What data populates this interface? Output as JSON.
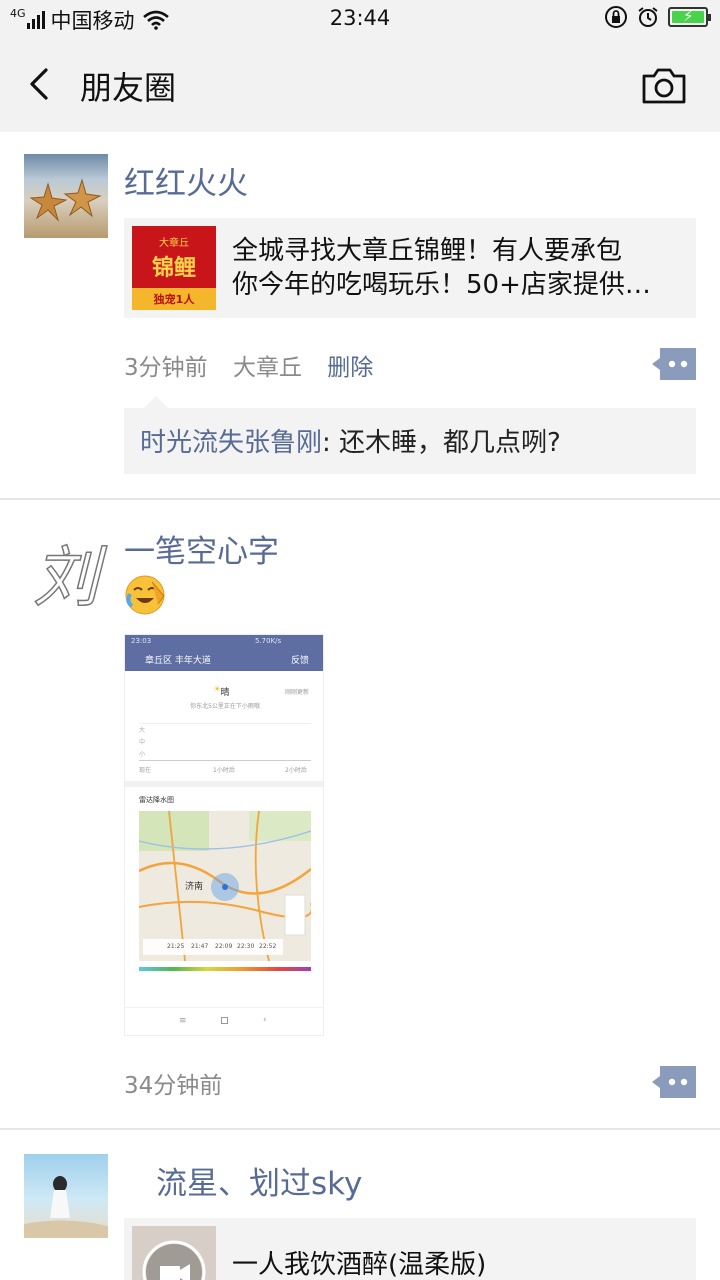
{
  "status_bar": {
    "network": "4G",
    "carrier": "中国移动",
    "time": "23:44"
  },
  "nav": {
    "title": "朋友圈"
  },
  "posts": [
    {
      "username": "红红火火",
      "link": {
        "thumb_top": "大章丘",
        "thumb_mid": "锦鲤",
        "thumb_bottom": "独宠1人",
        "line1": "全城寻找大章丘锦鲤！有人要承包",
        "line2": "你今年的吃喝玩乐！50+店家提供…"
      },
      "time": "3分钟前",
      "location": "大章丘",
      "delete_label": "删除",
      "comment": {
        "author": "时光流失张鲁刚",
        "separator": ": ",
        "text": "还木睡，都几点咧?"
      }
    },
    {
      "username": "一笔空心字",
      "avatar_text": "刘",
      "emoji": "crying-laughing-face",
      "screenshot": {
        "status_time": "23:03",
        "status_speed": "5.70K/s",
        "bar_title": "章丘区 丰年大道",
        "bar_feedback": "反馈",
        "weather": "晴",
        "weather_sub": "你东北5公里正在下小雨哦",
        "updated": "刚刚更新",
        "radar_title": "雷达降水图",
        "city": "济南",
        "levels": [
          "大",
          "中",
          "小"
        ],
        "times": [
          "现在",
          "1小时后",
          "2小时后"
        ],
        "timeline": [
          "21:25",
          "21:47",
          "22:09",
          "22:30",
          "22:52"
        ]
      },
      "time": "34分钟前"
    },
    {
      "username": "流星、划过sky",
      "music": {
        "title": "一人我饮酒醉(温柔版)"
      }
    }
  ],
  "colors": {
    "link_blue": "#576b95",
    "bar_bg": "#f2f2f2",
    "card_bg": "#f3f3f3",
    "meta_gray": "#8a8a8a"
  }
}
